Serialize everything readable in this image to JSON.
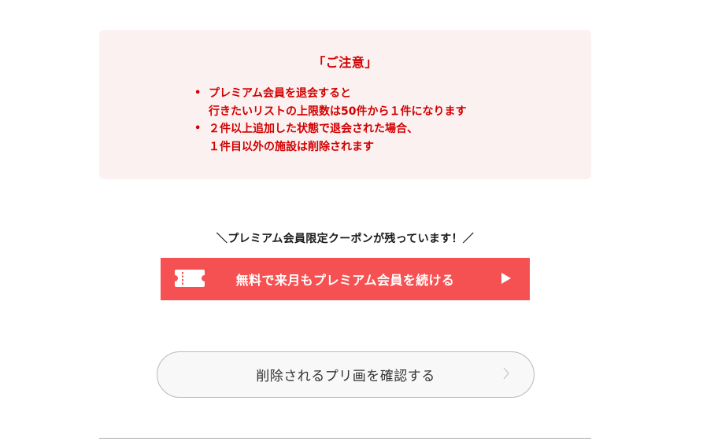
{
  "notice": {
    "title": "「ご注意」",
    "bullet_symbol": "•",
    "items": [
      {
        "lines": [
          "プレミアム会員を退会すると",
          "行きたいリストの上限数は50件から１件になります"
        ]
      },
      {
        "lines": [
          "２件以上追加した状態で退会された場合、",
          "１件目以外の施設は削除されます"
        ]
      }
    ]
  },
  "coupon": {
    "heading": "＼プレミアム会員限定クーポンが残っています！／",
    "button_label": "無料で来月もプレミアム会員を続ける",
    "icon_left": "ticket-icon",
    "icon_right": "play-icon"
  },
  "confirm": {
    "button_label": "削除されるプリ画を確認する",
    "icon": "chevron-right-icon"
  },
  "colors": {
    "notice_text": "#d20000",
    "notice_bg": "#fbf1f1",
    "coupon_button_bg": "#f65152",
    "confirm_button_bg": "#f8f8f8",
    "confirm_button_border": "#b9b9b9"
  }
}
